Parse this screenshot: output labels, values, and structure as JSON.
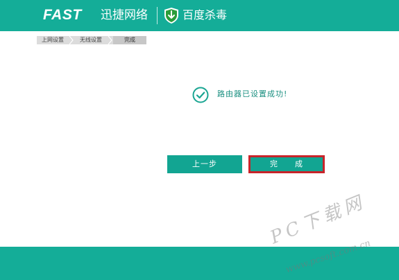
{
  "header": {
    "brand_fast": "FAST",
    "brand_name": "迅捷网络",
    "baidu_name": "百度杀毒"
  },
  "breadcrumb": {
    "items": [
      "上网设置",
      "无线设置",
      "完成"
    ]
  },
  "status": {
    "message": "路由器已设置成功!"
  },
  "buttons": {
    "prev_label": "上一步",
    "done_label": "完　　成"
  },
  "watermark": {
    "big": "PC下载网",
    "small": "www.pcsoft.com.cn"
  },
  "colors": {
    "brand_teal": "#14ad98",
    "button_teal": "#12a592",
    "highlight_red": "#c8242a"
  }
}
